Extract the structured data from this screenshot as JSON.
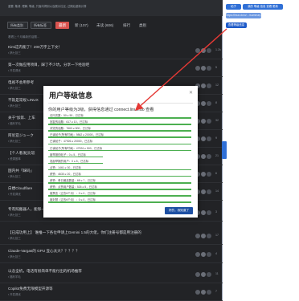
{
  "forum": {
    "announcement": "重要, 敬请, 理解, 等级, 只面向得到以及展示社区, 过期后重新计算",
    "tabs": {
      "chip1": "所有类别",
      "chip2": "所有标签",
      "latest": "最新",
      "new": "新 (107)",
      "unread": "未读 (606)",
      "top": "排行",
      "categories": "类别"
    },
    "notice": "看看上个月最新的话题…",
    "topics": [
      {
        "title": "Kimi这内能了！200万字上下文！",
        "sub": "▪ 搞七捻三",
        "count": "1.2k"
      },
      {
        "title": "第一次做应用项目，踩了不少坑，分享一下经验吧",
        "sub": "▪ 开发调优",
        "count": "5"
      },
      {
        "title": "电视不会用参考",
        "sub": "▪ 搞七捻三",
        "count": "12"
      },
      {
        "title": "不就是常规 LINUX",
        "sub": "▪ 搞七捻三",
        "count": "8"
      },
      {
        "title": "关于\"加第、上车",
        "sub": "▪ 福利羊毛",
        "count": "32"
      },
      {
        "title": "阿尼亚ジューク",
        "sub": "▪ 搞七捻三",
        "count": "9"
      },
      {
        "title": "【个人看发]比较",
        "sub": "▪ 资源荟萃",
        "count": "21"
      },
      {
        "title": "国内共「踩码」",
        "sub": "▪ 搞七捻三",
        "count": "6"
      },
      {
        "title": "白嫖Cloudflare",
        "sub": "▪ 开发调优",
        "count": "14"
      },
      {
        "title": "专有照搬器人，能够一个大家有话符以被刻开专合有的学者",
        "sub": "▪ 搞七捻三",
        "count": "3"
      },
      {
        "title": "【已成功用上】 谁推一下各位申请上Gemini 1.5的大佬，你们注册号都是用注册的",
        "sub": "▪ 搞七捻三",
        "count": "17"
      },
      {
        "title": "Claude-Vargas的 GPU 显心太大？？？？？",
        "sub": "▪ 搞七捻三",
        "count": "4"
      },
      {
        "title": "以念全机，电话有很简单不能付出的机场推荐",
        "sub": "▪ 福利羊毛",
        "count": "11"
      },
      {
        "title": "Copilot免费无限模型开源等",
        "sub": "▪ 开发调优",
        "count": "7"
      }
    ]
  },
  "dialog": {
    "title": "用户等级信息",
    "close": "✕",
    "level_line": "你的用户等级为3级，获得信息通过 connect.linux.do 查看",
    "requirements": [
      {
        "text": "访问次数：50 ≥ 50，已达标",
        "progress": 1.0
      },
      {
        "text": "回复的话题：617 ≥ 10，已达标",
        "progress": 1.0
      },
      {
        "text": "浏览的话题：7663 ≥ 500，已达标",
        "progress": 1.0
      },
      {
        "text": "已读帖子(所有时间)：9862 ≥ 20000，已达标",
        "progress": 1.0
      },
      {
        "text": "已读帖子：47926 ≥ 20000，已达标",
        "progress": 1.0
      },
      {
        "text": "已读帖子(所有时间)：47926 ≥ 500，已达标",
        "progress": 1.0
      },
      {
        "text": "被举报的帖子：0 ≤ 5，已达标",
        "progress": 0.38
      },
      {
        "text": "发起举报的用户：0 ≤ 5，已达标",
        "progress": 0.38
      },
      {
        "text": "点赞：1461 ≥ 30，已达标",
        "progress": 1.0
      },
      {
        "text": "获赞：4630 ≥ 20，已达标",
        "progress": 1.0
      },
      {
        "text": "获赞：单日最高数量：68 ≥ 7，已达标",
        "progress": 1.0
      },
      {
        "text": "获赞：点赞用户数量：526 ≥ 5，已达标",
        "progress": 1.0
      },
      {
        "text": "被禁言（过去6个月）：0 ≤ 0，已达标",
        "progress": 1.0
      },
      {
        "text": "被封禁（过去6个月）：0 ≤ 0，已达标",
        "progress": 1.0
      }
    ],
    "ok_label": "好的，我知道了"
  },
  "side": {
    "btn_top1": "帖子",
    "btn_top2": "我的 等级 信息 查看 更新",
    "btn_placeholder": "https://linux.do/u/…/summary",
    "btn_level": "查看等级信息"
  },
  "colors": {
    "accent": "#2f6fd6",
    "progress": "#4caf50",
    "latest_tab": "#d9534f",
    "arrow": "#e53935"
  }
}
